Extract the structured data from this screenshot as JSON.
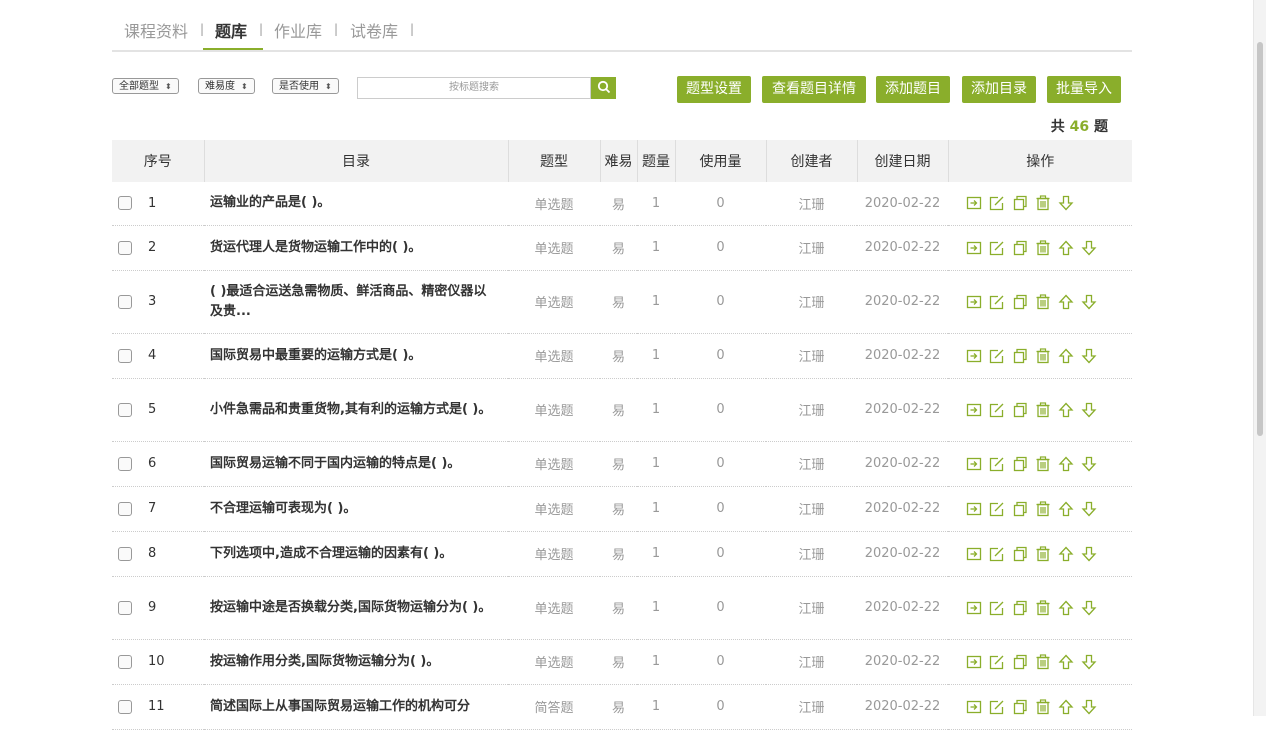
{
  "tabs": [
    {
      "label": "课程资料",
      "active": false
    },
    {
      "label": "题库",
      "active": true
    },
    {
      "label": "作业库",
      "active": false
    },
    {
      "label": "试卷库",
      "active": false
    }
  ],
  "separator": "|",
  "filters": {
    "type": "全部题型",
    "difficulty": "难易度",
    "usage": "是否使用",
    "arrow": "⬍"
  },
  "search": {
    "placeholder": "按标题搜索",
    "icon": "search-icon"
  },
  "buttons": {
    "type_settings": "题型设置",
    "view_details": "查看题目详情",
    "add_question": "添加题目",
    "add_directory": "添加目录",
    "batch_import": "批量导入"
  },
  "total": {
    "prefix": "共",
    "count": "46",
    "suffix": "题"
  },
  "columns": [
    "序号",
    "目录",
    "题型",
    "难易",
    "题量",
    "使用量",
    "创建者",
    "创建日期",
    "操作"
  ],
  "rows": [
    {
      "num": "1",
      "title": "运输业的产品是( )。",
      "type": "单选题",
      "difficulty": "易",
      "qty": "1",
      "used": "0",
      "creator": "江珊",
      "date": "2020-02-22",
      "up": false
    },
    {
      "num": "2",
      "title": "货运代理人是货物运输工作中的( )。",
      "type": "单选题",
      "difficulty": "易",
      "qty": "1",
      "used": "0",
      "creator": "江珊",
      "date": "2020-02-22",
      "up": true
    },
    {
      "num": "3",
      "title": "( )最适合运送急需物质、鲜活商品、精密仪器以及贵...",
      "type": "单选题",
      "difficulty": "易",
      "qty": "1",
      "used": "0",
      "creator": "江珊",
      "date": "2020-02-22",
      "up": true
    },
    {
      "num": "4",
      "title": "国际贸易中最重要的运输方式是( )。",
      "type": "单选题",
      "difficulty": "易",
      "qty": "1",
      "used": "0",
      "creator": "江珊",
      "date": "2020-02-22",
      "up": true
    },
    {
      "num": "5",
      "title": "小件急需品和贵重货物,其有利的运输方式是( )。",
      "type": "单选题",
      "difficulty": "易",
      "qty": "1",
      "used": "0",
      "creator": "江珊",
      "date": "2020-02-22",
      "up": true
    },
    {
      "num": "6",
      "title": "国际贸易运输不同于国内运输的特点是( )。",
      "type": "单选题",
      "difficulty": "易",
      "qty": "1",
      "used": "0",
      "creator": "江珊",
      "date": "2020-02-22",
      "up": true
    },
    {
      "num": "7",
      "title": "不合理运输可表现为( )。",
      "type": "单选题",
      "difficulty": "易",
      "qty": "1",
      "used": "0",
      "creator": "江珊",
      "date": "2020-02-22",
      "up": true
    },
    {
      "num": "8",
      "title": "下列选项中,造成不合理运输的因素有( )。",
      "type": "单选题",
      "difficulty": "易",
      "qty": "1",
      "used": "0",
      "creator": "江珊",
      "date": "2020-02-22",
      "up": true
    },
    {
      "num": "9",
      "title": "按运输中途是否换载分类,国际货物运输分为( )。",
      "type": "单选题",
      "difficulty": "易",
      "qty": "1",
      "used": "0",
      "creator": "江珊",
      "date": "2020-02-22",
      "up": true
    },
    {
      "num": "10",
      "title": "按运输作用分类,国际货物运输分为( )。",
      "type": "单选题",
      "difficulty": "易",
      "qty": "1",
      "used": "0",
      "creator": "江珊",
      "date": "2020-02-22",
      "up": true
    },
    {
      "num": "11",
      "title": "简述国际上从事国际贸易运输工作的机构可分",
      "type": "简答题",
      "difficulty": "易",
      "qty": "1",
      "used": "0",
      "creator": "江珊",
      "date": "2020-02-22",
      "up": true
    }
  ],
  "row_icons": [
    "move-icon",
    "edit-icon",
    "copy-icon",
    "delete-icon",
    "move-up-icon",
    "move-down-icon"
  ],
  "colors": {
    "accent": "#8aae2b",
    "header_bg": "#f2f2f2",
    "muted_text": "#999999"
  }
}
